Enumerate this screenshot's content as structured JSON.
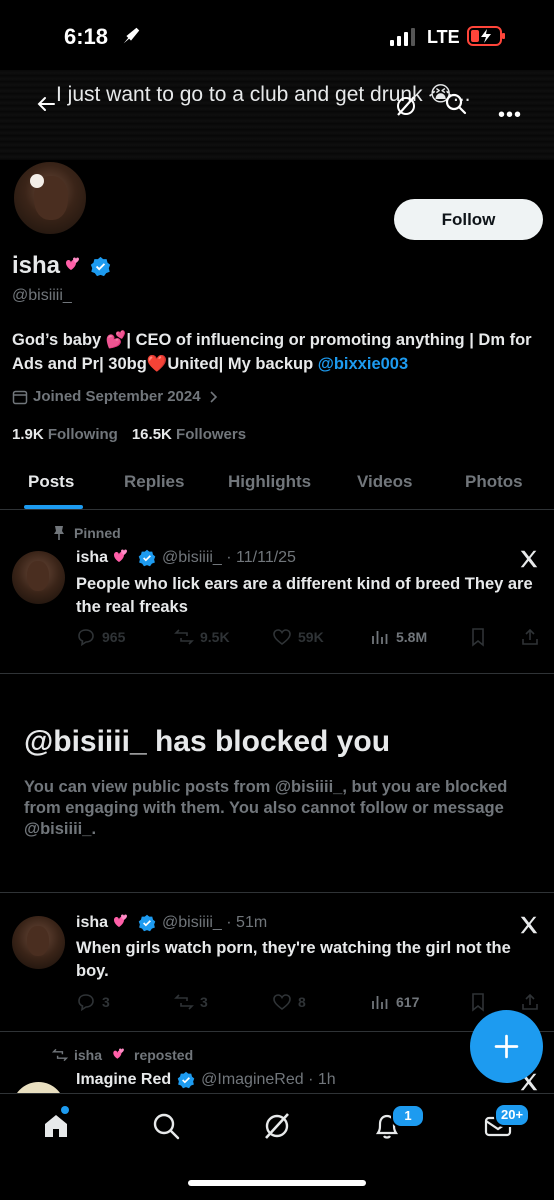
{
  "status_bar": {
    "time": "6:18",
    "network": "LTE"
  },
  "header": {
    "title": "I just want to go to a club and get drunk 😭..."
  },
  "profile": {
    "name": "isha",
    "handle": "@bisiiii_",
    "follow_label": "Follow",
    "bio_text": "God’s baby 💕| CEO of influencing or promoting anything | Dm for Ads and Pr| 30bg❤️United| My backup ",
    "bio_link": "@bixxie003",
    "joined": "Joined September 2024",
    "following_count": "1.9K",
    "following_label": "Following",
    "followers_count": "16.5K",
    "followers_label": "Followers"
  },
  "tabs": [
    "Posts",
    "Replies",
    "Highlights",
    "Videos",
    "Photos"
  ],
  "pinned_tweet": {
    "pinned_label": "Pinned",
    "name": "isha",
    "meta": "@bisiiii_ · 11/11/25",
    "text": "People who lick ears are a different kind of breed They are the real freaks",
    "replies": "965",
    "reposts": "9.5K",
    "likes": "59K",
    "views": "5.8M"
  },
  "blocked": {
    "title": "@bisiiii_ has blocked you",
    "text": "You can view public posts from @bisiiii_, but you are blocked from engaging with them. You also cannot follow or message @bisiiii_."
  },
  "tweet2": {
    "name": "isha",
    "meta": "@bisiiii_ · 51m",
    "text": "When girls watch porn, they're watching the girl not the boy.",
    "replies": "3",
    "reposts": "3",
    "likes": "8",
    "views": "617"
  },
  "tweet3": {
    "repost_user": "isha",
    "repost_label": "reposted",
    "name": "Imagine Red",
    "meta": "@ImagineRed · 1h"
  },
  "nav": {
    "notifications_badge": "1",
    "messages_badge": "20+"
  },
  "colors": {
    "accent": "#1d9bf0",
    "background": "#000000",
    "muted": "#71767b"
  }
}
